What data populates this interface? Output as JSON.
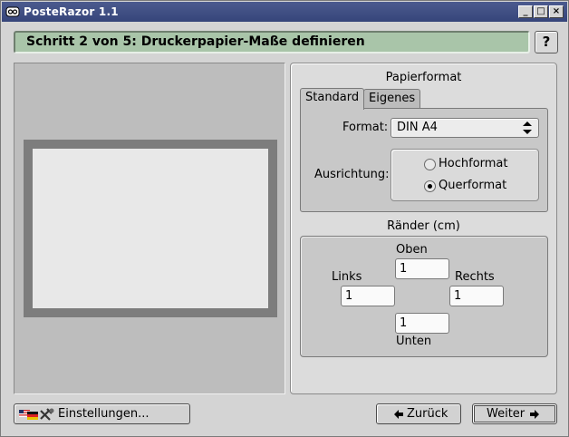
{
  "window": {
    "title": "PosteRazor 1.1",
    "icon": "app-razor-icon",
    "controls": {
      "minimize": "_",
      "maximize": "□",
      "close": "×"
    }
  },
  "header": {
    "step_title": "Schritt 2 von 5: Druckerpapier-Maße definieren",
    "help_label": "?"
  },
  "paper_format": {
    "title": "Papierformat",
    "tabs": [
      {
        "label": "Standard",
        "active": true
      },
      {
        "label": "Eigenes",
        "active": false
      }
    ],
    "format_label": "Format:",
    "format_value": "DIN A4",
    "orientation_label": "Ausrichtung:",
    "orientation_options": [
      {
        "label": "Hochformat",
        "checked": false
      },
      {
        "label": "Querformat",
        "checked": true
      }
    ]
  },
  "margins": {
    "title": "Ränder (cm)",
    "top_label": "Oben",
    "top_value": "1",
    "left_label": "Links",
    "left_value": "1",
    "right_label": "Rechts",
    "right_value": "1",
    "bottom_label": "Unten",
    "bottom_value": "1"
  },
  "footer": {
    "settings_label": "Einstellungen...",
    "settings_icon": "flags-tools-icon",
    "back_label": "Zurück",
    "back_icon": "arrow-left-icon",
    "next_label": "Weiter",
    "next_icon": "arrow-right-icon"
  },
  "colors": {
    "titlebar": "#3f4e84",
    "step_header": "#a9c5a9",
    "preview_background": "#bdbdbd",
    "paper_border": "#7d7d7d",
    "paper": "#e8e8e8"
  }
}
